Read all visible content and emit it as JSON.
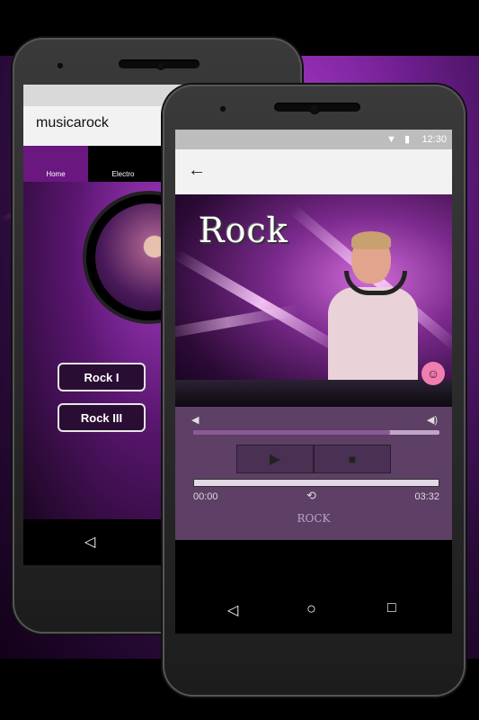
{
  "phone_back": {
    "app_title": "musicarock",
    "tabs": [
      {
        "label": "Home",
        "active": true
      },
      {
        "label": "Electro",
        "active": false
      }
    ],
    "buttons": [
      "Rock I",
      "Rock III"
    ],
    "nav": {
      "back": "◁",
      "home": "○"
    }
  },
  "phone_front": {
    "status": {
      "time": "12:30",
      "icons": "▼ ▮"
    },
    "toolbar": {
      "back_icon": "←"
    },
    "video_title": "Rock",
    "player": {
      "volume_low_icon": "◀",
      "volume_high_icon": "◀)",
      "seek_level": 0.8,
      "play_icon": "▶",
      "stop_icon": "■",
      "elapsed": "00:00",
      "duration": "03:32",
      "repeat_icon": "⟲",
      "track_name": "ROCK"
    },
    "nav": {
      "back": "◁",
      "home": "○",
      "recent": "□"
    }
  },
  "colors": {
    "accent_purple": "#6a1780",
    "player_bg": "#5e3f66",
    "statusbar": "#bdbdbd"
  }
}
